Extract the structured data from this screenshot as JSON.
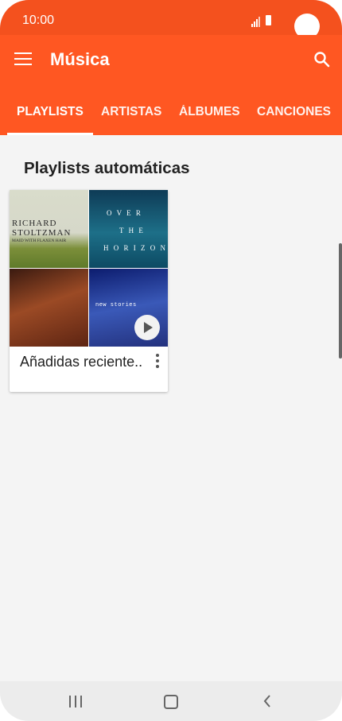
{
  "status_bar": {
    "time": "10:00"
  },
  "app_bar": {
    "title": "Música"
  },
  "tabs": [
    {
      "label": "PLAYLISTS",
      "active": true
    },
    {
      "label": "ARTISTAS",
      "active": false
    },
    {
      "label": "ÁLBUMES",
      "active": false
    },
    {
      "label": "CANCIONES",
      "active": false
    }
  ],
  "section": {
    "title": "Playlists automáticas"
  },
  "playlist_card": {
    "name": "Añadidas reciente..",
    "album_art": [
      {
        "lines": [
          "RICHARD",
          "STOLTZMAN",
          "MAID WITH FLAXEN HAIR"
        ]
      },
      {
        "lines": [
          "O V E R",
          "T H E",
          "H O R I Z O N"
        ]
      },
      {
        "lines": []
      },
      {
        "lines": [
          "new stories"
        ]
      }
    ]
  },
  "colors": {
    "accent": "#ff5722",
    "status_bar": "#f4511e",
    "background": "#f4f4f4"
  }
}
